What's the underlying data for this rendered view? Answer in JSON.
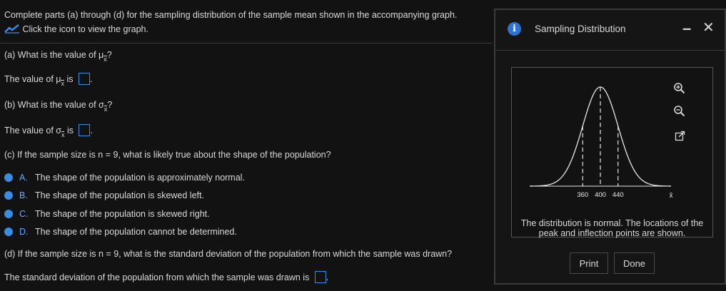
{
  "intro": {
    "text": "Complete parts (a) through (d) for the sampling distribution of the sample mean shown in the accompanying graph.",
    "graph_link": "Click the icon to view the graph."
  },
  "part_a": {
    "label": "(a)",
    "question_prefix": "What is the value of ",
    "symbol": "μ",
    "subscript": "x",
    "question_suffix": "?",
    "answer_prefix": "The value of ",
    "answer_mid": " is ",
    "answer_suffix": "."
  },
  "part_b": {
    "label": "(b)",
    "question_prefix": "What is the value of ",
    "symbol": "σ",
    "subscript": "x",
    "question_suffix": "?",
    "answer_prefix": "The value of ",
    "answer_mid": " is ",
    "answer_suffix": "."
  },
  "part_c": {
    "label": "(c)",
    "question": " If the sample size is n = 9, what is likely true about the shape of the population?",
    "options": [
      {
        "letter": "A.",
        "text": "The shape of the population is approximately normal."
      },
      {
        "letter": "B.",
        "text": "The shape of the population is skewed left."
      },
      {
        "letter": "C.",
        "text": "The shape of the population is skewed right."
      },
      {
        "letter": "D.",
        "text": "The shape of the population cannot be determined."
      }
    ]
  },
  "part_d": {
    "label": "(d)",
    "question": " If the sample size is n = 9, what is the standard deviation of the population from which the sample was drawn?",
    "answer_prefix": "The standard deviation of the population from which the sample was drawn is ",
    "answer_suffix": "."
  },
  "popup": {
    "title": "Sampling Distribution",
    "info_icon": "i",
    "minimize_icon": "–",
    "close_icon": "✕",
    "caption_line1": "The distribution is normal. The locations of the",
    "caption_line2": "peak and inflection points are shown.",
    "print_label": "Print",
    "done_label": "Done",
    "zoom_in_icon": "zoom-in-icon",
    "zoom_out_icon": "zoom-out-icon",
    "popout_icon": "popout-icon"
  },
  "chart_data": {
    "type": "line",
    "title": "",
    "xlabel": "x̄",
    "ylabel": "",
    "x_ticks": [
      "360",
      "400",
      "440"
    ],
    "mean": 400,
    "inflection_points": [
      360,
      440
    ],
    "xlim": [
      240,
      560
    ],
    "distribution": "normal"
  },
  "colors": {
    "background": "#121212",
    "text": "#d8d8d8",
    "accent": "#3b8be0",
    "border": "#3a3a3a"
  }
}
